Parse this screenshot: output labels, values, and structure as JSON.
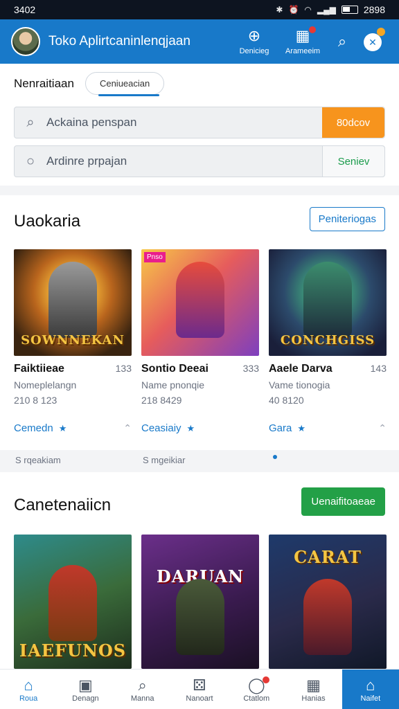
{
  "status": {
    "time": "3402",
    "battery": "2898"
  },
  "appbar": {
    "title": "Toko Aplirtcaninlenqjaan",
    "actions": [
      {
        "label": "Denicieg",
        "icon": "globe-icon"
      },
      {
        "label": "Arameeim",
        "icon": "calendar-icon"
      }
    ]
  },
  "tabs": {
    "active_label": "Nenraitiaan",
    "pill_label": "Ceniueacian"
  },
  "search": {
    "primary_placeholder": "Ackaina penspan",
    "primary_button": "80dcov",
    "secondary_placeholder": "Ardinre prpajan",
    "secondary_button": "Seniev"
  },
  "section1": {
    "title": "Uaokaria",
    "button": "Peniteriogas",
    "cards": [
      {
        "art_text": "SOWNNEKAN",
        "tag": "",
        "name": "Faiktiieae",
        "num": "133",
        "sub": "Nomeplelangn",
        "meta": "210 8 123",
        "link": "Cemedn"
      },
      {
        "art_text": "",
        "tag": "Pnso",
        "name": "Sontio Deeai",
        "num": "333",
        "sub": "Name pnonqie",
        "meta": "218 8429",
        "link": "Ceasiaiy"
      },
      {
        "art_text": "CONCHGISS",
        "tag": "",
        "name": "Aaele Darva",
        "num": "143",
        "sub": "Vame tionogia",
        "meta": "40 8120",
        "link": "Gara"
      }
    ],
    "footnotes": [
      "S rqeakiam",
      "S mgeikiar"
    ]
  },
  "section2": {
    "title": "Canetenaiicn",
    "button": "Uenaifitoaeae",
    "cards": [
      {
        "art_text": "IAEFUNOS"
      },
      {
        "art_text": "DARUAN"
      },
      {
        "art_text": "CARAT"
      }
    ]
  },
  "bottomnav": [
    {
      "label": "Roua",
      "icon": "home-icon"
    },
    {
      "label": "Denagn",
      "icon": "gamepad-icon"
    },
    {
      "label": "Manna",
      "icon": "search-icon"
    },
    {
      "label": "Nanoart",
      "icon": "dice-icon"
    },
    {
      "label": "Ctatlom",
      "icon": "chat-icon"
    },
    {
      "label": "Hanias",
      "icon": "grid-icon"
    },
    {
      "label": "Naifet",
      "icon": "store-icon"
    }
  ]
}
